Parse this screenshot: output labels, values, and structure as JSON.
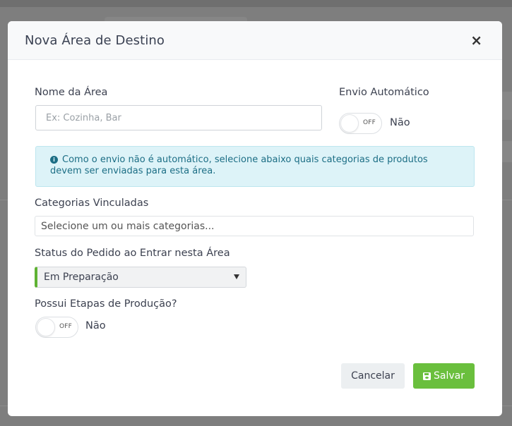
{
  "modal": {
    "title": "Nova Área de Destino",
    "close_label": "×"
  },
  "form": {
    "name_label": "Nome da Área",
    "name_placeholder": "Ex: Cozinha, Bar",
    "name_value": "",
    "auto_send_label": "Envio Automático",
    "auto_send_toggle_text": "OFF",
    "auto_send_state_label": "Não",
    "alert_text": "Como o envio não é automático, selecione abaixo quais categorias de produtos devem ser enviadas para esta área.",
    "categories_label": "Categorias Vinculadas",
    "categories_placeholder": "Selecione um ou mais categorias...",
    "status_label": "Status do Pedido ao Entrar nesta Área",
    "status_selected": "Em Preparação",
    "stages_label": "Possui Etapas de Produção?",
    "stages_toggle_text": "OFF",
    "stages_state_label": "Não"
  },
  "actions": {
    "cancel_label": "Cancelar",
    "save_label": "Salvar"
  },
  "colors": {
    "accent_green": "#6abf3d",
    "select_border_green": "#5fb233",
    "info_bg": "#ddf3f8",
    "info_text": "#1c6e85"
  },
  "icons": {
    "close": "close-icon",
    "info": "info-circle-icon",
    "save": "floppy-disk-icon",
    "dropdown": "caret-down-icon"
  }
}
